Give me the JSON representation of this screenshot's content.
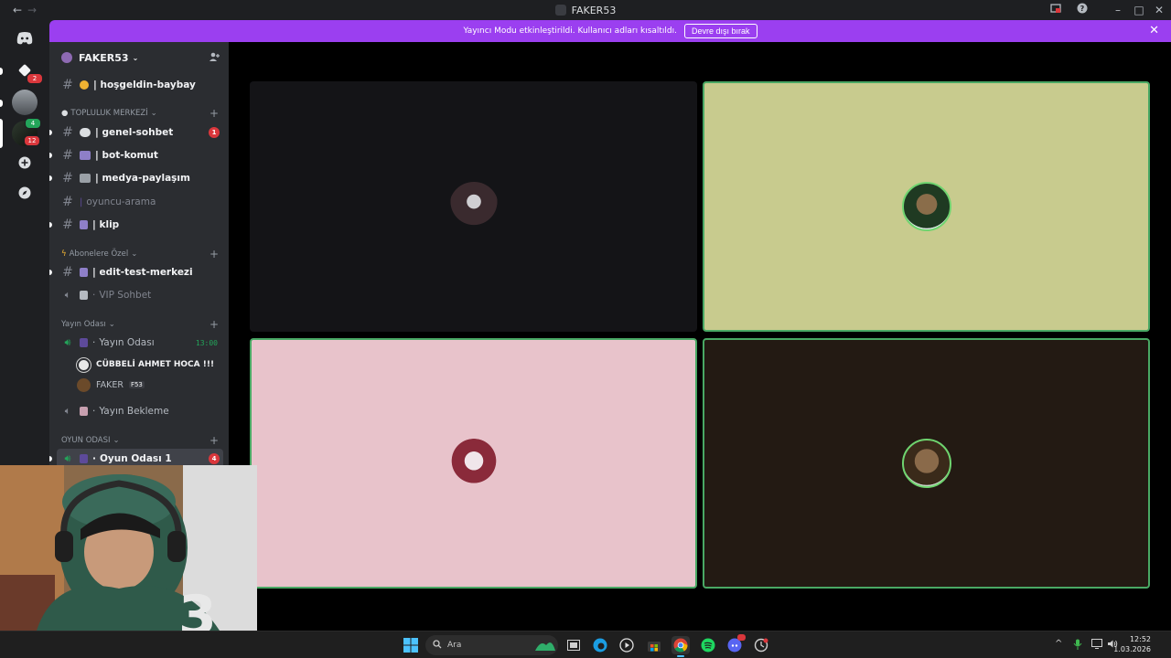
{
  "window": {
    "title": "FAKER53"
  },
  "guilds": {
    "badges": [
      "2",
      "12"
    ],
    "self_badge": "4"
  },
  "banner": {
    "message": "Yayıncı Modu etkinleştirildi. Kullanıcı adları kısaltıldı.",
    "button": "Devre dışı bırak"
  },
  "server": {
    "name": "FAKER53",
    "channels_top": [
      {
        "name": "| hoşgeldin-baybay"
      }
    ],
    "categories": {
      "topluluk": "TOPLULUK MERKEZİ",
      "abone": "Abonelere Özel",
      "yayin": "Yayın Odası",
      "oyun": "OYUN ODASI"
    },
    "topluluk_channels": [
      {
        "name": "| genel-sohbet",
        "badge": "1"
      },
      {
        "name": "| bot-komut"
      },
      {
        "name": "| medya-paylaşım"
      },
      {
        "name": "oyuncu-arama"
      },
      {
        "name": "| klip"
      }
    ],
    "abone_channels": [
      {
        "name": "| edit-test-merkezi"
      },
      {
        "name": "VIP Sohbet"
      }
    ],
    "yayin_channels": [
      {
        "name": "Yayın Odası",
        "timer": "13:00"
      },
      {
        "name": "Yayın Bekleme"
      }
    ],
    "yayin_users": [
      {
        "name": "CÜBBELİ AHMET HOCA !!!"
      },
      {
        "name": "FAKER",
        "tag": "F53"
      }
    ],
    "oyun_channels": [
      {
        "name": "Oyun Odası 1",
        "badge": "4"
      }
    ]
  },
  "taskbar": {
    "search_placeholder": "Ara",
    "time": "12:52",
    "date": "1.03.2026"
  },
  "colors": {
    "accent": "#9b3ff0",
    "speaking": "#49a864",
    "tile_1": "#141417",
    "tile_2": "#c8cb8e",
    "tile_3": "#e8c3cb",
    "tile_4": "#231a13"
  }
}
